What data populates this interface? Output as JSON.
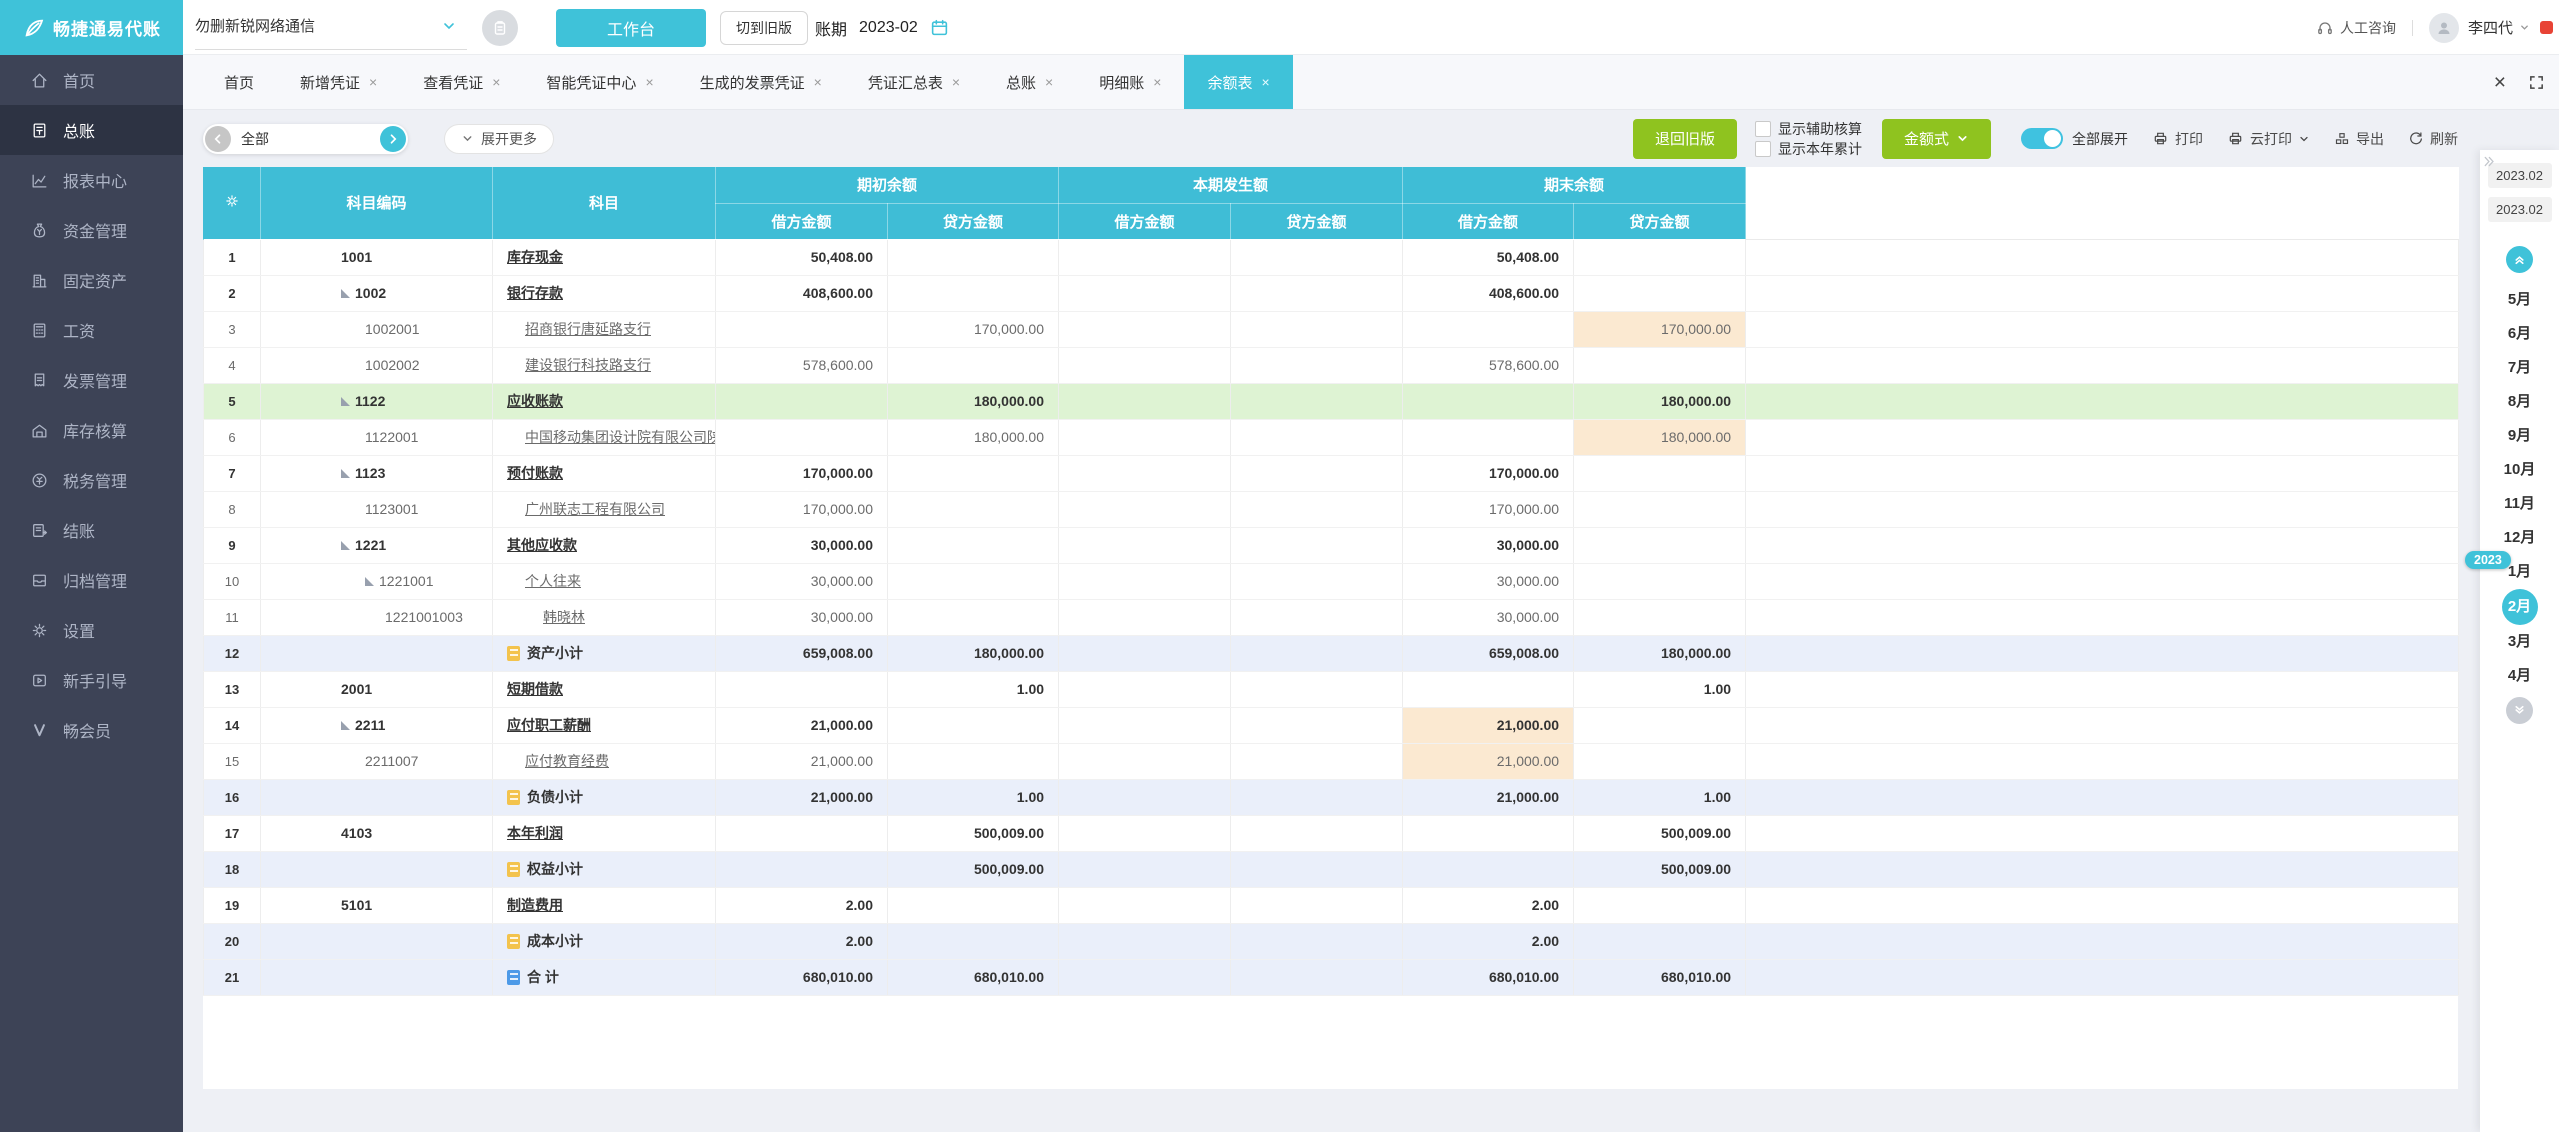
{
  "brand": {
    "logo_text": "畅捷通易代账"
  },
  "topbar": {
    "company": "勿删新锐网络通信",
    "workbench": "工作台",
    "switch_old": "切到旧版",
    "period_label": "账期",
    "period_value": "2023-02",
    "consult": "人工咨询",
    "user": "李四代"
  },
  "sidebar": {
    "items": [
      {
        "id": "home",
        "icon": "home",
        "label": "首页",
        "active": false
      },
      {
        "id": "ledger",
        "icon": "ledger",
        "label": "总账",
        "active": true
      },
      {
        "id": "reports",
        "icon": "report",
        "label": "报表中心",
        "active": false
      },
      {
        "id": "funds",
        "icon": "funds",
        "label": "资金管理",
        "active": false
      },
      {
        "id": "assets",
        "icon": "asset",
        "label": "固定资产",
        "active": false
      },
      {
        "id": "salary",
        "icon": "salary",
        "label": "工资",
        "active": false
      },
      {
        "id": "invoice",
        "icon": "invoice",
        "label": "发票管理",
        "active": false
      },
      {
        "id": "inventory",
        "icon": "inventory",
        "label": "库存核算",
        "active": false
      },
      {
        "id": "tax",
        "icon": "tax",
        "label": "税务管理",
        "active": false
      },
      {
        "id": "closing",
        "icon": "closing",
        "label": "结账",
        "active": false
      },
      {
        "id": "archive",
        "icon": "archive",
        "label": "归档管理",
        "active": false
      },
      {
        "id": "settings",
        "icon": "settings",
        "label": "设置",
        "active": false
      },
      {
        "id": "guide",
        "icon": "guide",
        "label": "新手引导",
        "active": false
      },
      {
        "id": "vip",
        "icon": "vip",
        "label": "畅会员",
        "active": false
      }
    ]
  },
  "tabs": [
    {
      "label": "首页",
      "closable": false,
      "active": false
    },
    {
      "label": "新增凭证",
      "closable": true,
      "active": false
    },
    {
      "label": "查看凭证",
      "closable": true,
      "active": false
    },
    {
      "label": "智能凭证中心",
      "closable": true,
      "active": false
    },
    {
      "label": "生成的发票凭证",
      "closable": true,
      "active": false
    },
    {
      "label": "凭证汇总表",
      "closable": true,
      "active": false
    },
    {
      "label": "总账",
      "closable": true,
      "active": false
    },
    {
      "label": "明细账",
      "closable": true,
      "active": false
    },
    {
      "label": "余额表",
      "closable": true,
      "active": true
    }
  ],
  "toolbar": {
    "filter_value": "全部",
    "expand_more": "展开更多",
    "back_old": "退回旧版",
    "checkboxes": [
      {
        "label": "显示辅助核算",
        "checked": false
      },
      {
        "label": "显示本年累计",
        "checked": false
      }
    ],
    "amount_style": "金额式",
    "toggle_label": "全部展开",
    "print": "打印",
    "cloud_print": "云打印",
    "export": "导出",
    "refresh": "刷新"
  },
  "table": {
    "headers": {
      "code": "科目编码",
      "subject": "科目",
      "groups": [
        "期初余额",
        "本期发生额",
        "期末余额"
      ],
      "debit": "借方金额",
      "credit": "贷方金额"
    },
    "rows": [
      {
        "n": "1",
        "code": "1001",
        "lvl": 1,
        "arr": false,
        "name": "库存现金",
        "icon": null,
        "u": true,
        "b": true,
        "child": false,
        "bg": "",
        "vals": [
          "50,408.00",
          "",
          "",
          "",
          "50,408.00",
          ""
        ],
        "hl": []
      },
      {
        "n": "2",
        "code": "1002",
        "lvl": 1,
        "arr": true,
        "name": "银行存款",
        "icon": null,
        "u": true,
        "b": true,
        "child": false,
        "bg": "",
        "vals": [
          "408,600.00",
          "",
          "",
          "",
          "408,600.00",
          ""
        ],
        "hl": []
      },
      {
        "n": "3",
        "code": "1002001",
        "lvl": 2,
        "arr": false,
        "name": "招商银行唐延路支行",
        "icon": null,
        "u": true,
        "b": false,
        "child": true,
        "bg": "",
        "vals": [
          "",
          "170,000.00",
          "",
          "",
          "",
          "170,000.00"
        ],
        "hl": [
          5
        ]
      },
      {
        "n": "4",
        "code": "1002002",
        "lvl": 2,
        "arr": false,
        "name": "建设银行科技路支行",
        "icon": null,
        "u": true,
        "b": false,
        "child": true,
        "bg": "",
        "vals": [
          "578,600.00",
          "",
          "",
          "",
          "578,600.00",
          ""
        ],
        "hl": []
      },
      {
        "n": "5",
        "code": "1122",
        "lvl": 1,
        "arr": true,
        "name": "应收账款",
        "icon": null,
        "u": true,
        "b": true,
        "child": false,
        "bg": "green",
        "vals": [
          "",
          "180,000.00",
          "",
          "",
          "",
          "180,000.00"
        ],
        "hl": [
          5
        ]
      },
      {
        "n": "6",
        "code": "1122001",
        "lvl": 2,
        "arr": false,
        "name": "中国移动集团设计院有限公司陕西",
        "icon": null,
        "u": true,
        "b": false,
        "child": true,
        "bg": "",
        "vals": [
          "",
          "180,000.00",
          "",
          "",
          "",
          "180,000.00"
        ],
        "hl": [
          5
        ]
      },
      {
        "n": "7",
        "code": "1123",
        "lvl": 1,
        "arr": true,
        "name": "预付账款",
        "icon": null,
        "u": true,
        "b": true,
        "child": false,
        "bg": "",
        "vals": [
          "170,000.00",
          "",
          "",
          "",
          "170,000.00",
          ""
        ],
        "hl": []
      },
      {
        "n": "8",
        "code": "1123001",
        "lvl": 2,
        "arr": false,
        "name": "广州联志工程有限公司",
        "icon": null,
        "u": true,
        "b": false,
        "child": true,
        "bg": "",
        "vals": [
          "170,000.00",
          "",
          "",
          "",
          "170,000.00",
          ""
        ],
        "hl": []
      },
      {
        "n": "9",
        "code": "1221",
        "lvl": 1,
        "arr": true,
        "name": "其他应收款",
        "icon": null,
        "u": true,
        "b": true,
        "child": false,
        "bg": "",
        "vals": [
          "30,000.00",
          "",
          "",
          "",
          "30,000.00",
          ""
        ],
        "hl": []
      },
      {
        "n": "10",
        "code": "1221001",
        "lvl": 2,
        "arr": true,
        "name": "个人往来",
        "icon": null,
        "u": true,
        "b": false,
        "child": true,
        "bg": "",
        "vals": [
          "30,000.00",
          "",
          "",
          "",
          "30,000.00",
          ""
        ],
        "hl": []
      },
      {
        "n": "11",
        "code": "1221001003",
        "lvl": 3,
        "arr": false,
        "name": "韩晓林",
        "icon": null,
        "u": true,
        "b": false,
        "child": true,
        "bg": "",
        "vals": [
          "30,000.00",
          "",
          "",
          "",
          "30,000.00",
          ""
        ],
        "hl": []
      },
      {
        "n": "12",
        "code": "",
        "lvl": 1,
        "arr": false,
        "name": "资产小计",
        "icon": "y",
        "u": false,
        "b": true,
        "child": false,
        "bg": "blue",
        "vals": [
          "659,008.00",
          "180,000.00",
          "",
          "",
          "659,008.00",
          "180,000.00"
        ],
        "hl": []
      },
      {
        "n": "13",
        "code": "2001",
        "lvl": 1,
        "arr": false,
        "name": "短期借款",
        "icon": null,
        "u": true,
        "b": true,
        "child": false,
        "bg": "",
        "vals": [
          "",
          "1.00",
          "",
          "",
          "",
          "1.00"
        ],
        "hl": []
      },
      {
        "n": "14",
        "code": "2211",
        "lvl": 1,
        "arr": true,
        "name": "应付职工薪酬",
        "icon": null,
        "u": true,
        "b": true,
        "child": false,
        "bg": "",
        "vals": [
          "21,000.00",
          "",
          "",
          "",
          "21,000.00",
          ""
        ],
        "hl": [
          4
        ]
      },
      {
        "n": "15",
        "code": "2211007",
        "lvl": 2,
        "arr": false,
        "name": "应付教育经费",
        "icon": null,
        "u": true,
        "b": false,
        "child": true,
        "bg": "",
        "vals": [
          "21,000.00",
          "",
          "",
          "",
          "21,000.00",
          ""
        ],
        "hl": [
          4
        ]
      },
      {
        "n": "16",
        "code": "",
        "lvl": 1,
        "arr": false,
        "name": "负债小计",
        "icon": "y",
        "u": false,
        "b": true,
        "child": false,
        "bg": "blue",
        "vals": [
          "21,000.00",
          "1.00",
          "",
          "",
          "21,000.00",
          "1.00"
        ],
        "hl": []
      },
      {
        "n": "17",
        "code": "4103",
        "lvl": 1,
        "arr": false,
        "name": "本年利润",
        "icon": null,
        "u": true,
        "b": true,
        "child": false,
        "bg": "",
        "vals": [
          "",
          "500,009.00",
          "",
          "",
          "",
          "500,009.00"
        ],
        "hl": []
      },
      {
        "n": "18",
        "code": "",
        "lvl": 1,
        "arr": false,
        "name": "权益小计",
        "icon": "y",
        "u": false,
        "b": true,
        "child": false,
        "bg": "blue",
        "vals": [
          "",
          "500,009.00",
          "",
          "",
          "",
          "500,009.00"
        ],
        "hl": []
      },
      {
        "n": "19",
        "code": "5101",
        "lvl": 1,
        "arr": false,
        "name": "制造费用",
        "icon": null,
        "u": true,
        "b": true,
        "child": false,
        "bg": "",
        "vals": [
          "2.00",
          "",
          "",
          "",
          "2.00",
          ""
        ],
        "hl": []
      },
      {
        "n": "20",
        "code": "",
        "lvl": 1,
        "arr": false,
        "name": "成本小计",
        "icon": "y",
        "u": false,
        "b": true,
        "child": false,
        "bg": "blue",
        "vals": [
          "2.00",
          "",
          "",
          "",
          "2.00",
          ""
        ],
        "hl": []
      },
      {
        "n": "21",
        "code": "",
        "lvl": 1,
        "arr": false,
        "name": "合 计",
        "icon": "b",
        "u": false,
        "b": true,
        "child": false,
        "bg": "blue",
        "vals": [
          "680,010.00",
          "680,010.00",
          "",
          "",
          "680,010.00",
          "680,010.00"
        ],
        "hl": []
      }
    ]
  },
  "month_panel": {
    "period_from": "2023.02",
    "period_to": "2023.02",
    "year_badge": "2023",
    "months": [
      "5月",
      "6月",
      "7月",
      "8月",
      "9月",
      "10月",
      "11月",
      "12月",
      "1月",
      "2月",
      "3月",
      "4月"
    ],
    "selected": "2月"
  }
}
